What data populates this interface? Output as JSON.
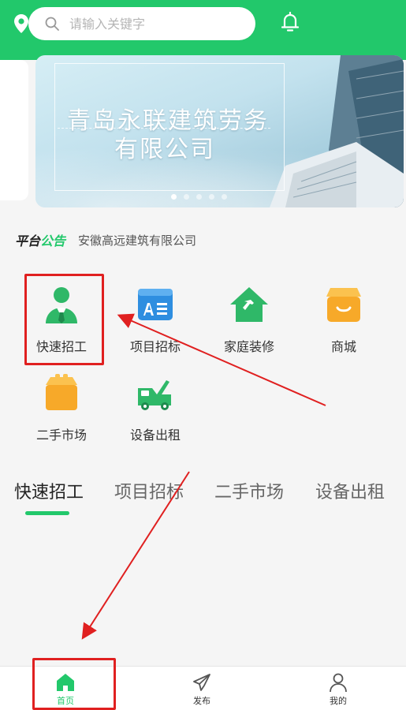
{
  "header": {
    "search_placeholder": "请输入关键字",
    "accent_color": "#22c86b",
    "icons": {
      "location": "location-pin-icon",
      "search": "search-icon",
      "notification": "bell-icon"
    }
  },
  "banner": {
    "line1": "青岛永联建筑劳务",
    "line2": "有限公司",
    "dots_total": 5,
    "active_dot": 1
  },
  "notice": {
    "label_part1": "平台",
    "label_part2": "公告",
    "text": "安徽高远建筑有限公司"
  },
  "categories": [
    {
      "label": "快速招工",
      "icon": "worker-icon"
    },
    {
      "label": "项目招标",
      "icon": "document-icon"
    },
    {
      "label": "家庭装修",
      "icon": "house-hammer-icon"
    },
    {
      "label": "商城",
      "icon": "shop-icon"
    },
    {
      "label": "二手市场",
      "icon": "box-icon"
    },
    {
      "label": "设备出租",
      "icon": "tow-truck-icon"
    }
  ],
  "tabs": [
    {
      "label": "快速招工",
      "active": true
    },
    {
      "label": "项目招标",
      "active": false
    },
    {
      "label": "二手市场",
      "active": false
    },
    {
      "label": "设备出租",
      "active": false
    }
  ],
  "bottom_nav": [
    {
      "label": "首页",
      "icon": "home-icon",
      "active": true
    },
    {
      "label": "发布",
      "icon": "send-icon",
      "active": false
    },
    {
      "label": "我的",
      "icon": "user-icon",
      "active": false
    }
  ],
  "annotation_color": "#e02020"
}
